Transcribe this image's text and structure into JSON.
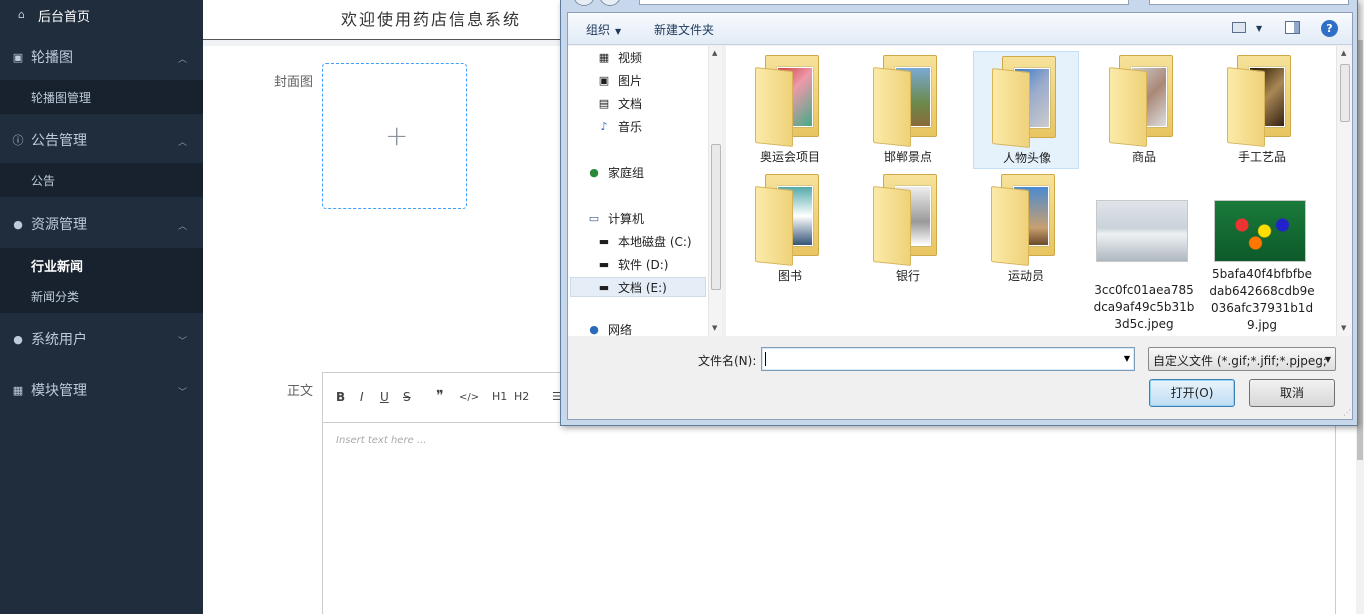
{
  "sidebar": {
    "home": "后台首页",
    "groups": [
      {
        "label": "轮播图",
        "icon": "image-icon",
        "sub": [
          "轮播图管理"
        ]
      },
      {
        "label": "公告管理",
        "icon": "info-icon",
        "sub": [
          "公告"
        ]
      },
      {
        "label": "资源管理",
        "icon": "location-icon",
        "sub": [
          "行业新闻",
          "新闻分类"
        ]
      },
      {
        "label": "系统用户",
        "icon": "user-icon"
      },
      {
        "label": "模块管理",
        "icon": "grid-icon"
      }
    ]
  },
  "header": {
    "title": "欢迎使用药店信息系统"
  },
  "form": {
    "cover_label": "封面图",
    "content_label": "正文",
    "editor_placeholder": "Insert text here ...",
    "toolbar": [
      "B",
      "I",
      "U",
      "S",
      "❞",
      "</>",
      "H1",
      "H2"
    ]
  },
  "dialog": {
    "organize": "组织",
    "new_folder": "新建文件夹",
    "help": "?",
    "nav": [
      "视频",
      "图片",
      "文档",
      "音乐",
      "家庭组",
      "计算机",
      "本地磁盘 (C:)",
      "软件 (D:)",
      "文档 (E:)",
      "网络"
    ],
    "folders": [
      "奥运会项目",
      "邯郸景点",
      "人物头像",
      "商品",
      "手工艺品",
      "图书",
      "银行",
      "运动员"
    ],
    "files": [
      {
        "name": "3cc0fc01aea785dca9af49c5b31b3d5c.jpeg"
      },
      {
        "name": "5bafa40f4bfbfbedab642668cdb9e036afc37931b1d9.jpg"
      }
    ],
    "filename_label": "文件名(N):",
    "filename_value": "",
    "filter": "自定义文件 (*.gif;*.jfif;*.pjpeg;",
    "open_button": "打开(O)",
    "cancel_button": "取消"
  }
}
